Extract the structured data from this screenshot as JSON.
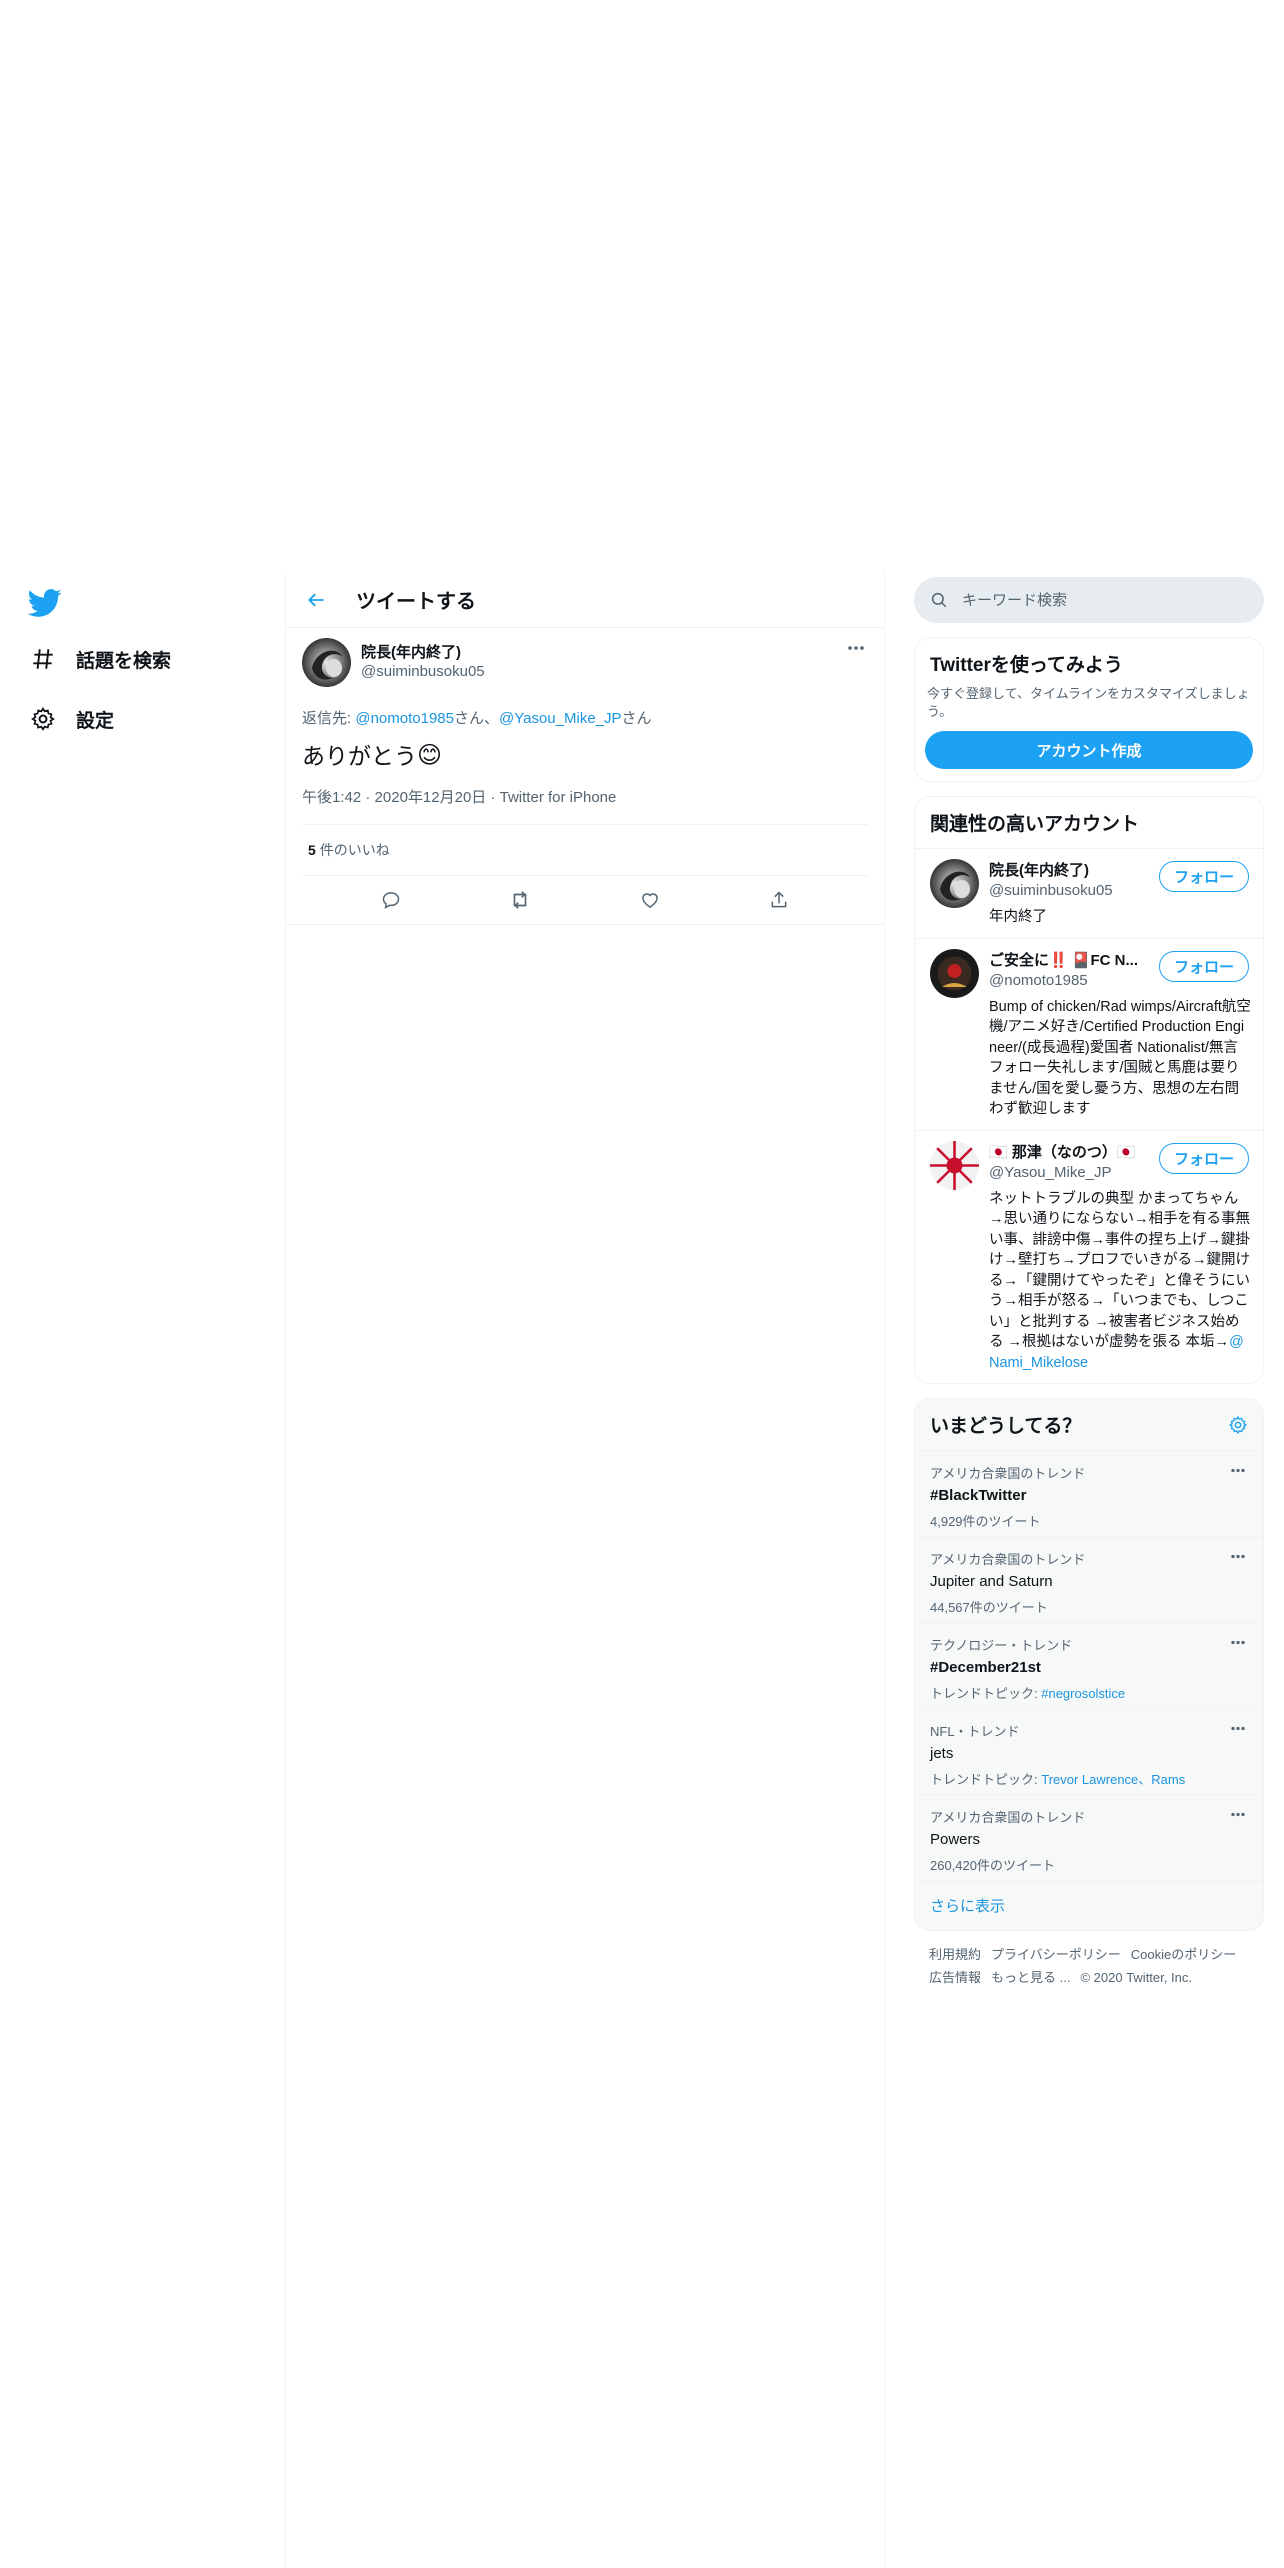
{
  "nav": {
    "items": [
      {
        "label": "話題を検索"
      },
      {
        "label": "設定"
      }
    ]
  },
  "main": {
    "header_title": "ツイートする",
    "tweet": {
      "author_name": "院長(年内終了)",
      "author_handle": "@suiminbusoku05",
      "reply_prefix": "返信先: ",
      "reply_mention_1": "@nomoto1985",
      "reply_sep": "さん、",
      "reply_mention_2": "@Yasou_Mike_JP",
      "reply_suffix": "さん",
      "text": "ありがとう",
      "emoji": "😊",
      "time": "午後1:42",
      "date": "2020年12月20日",
      "source": "Twitter for iPhone",
      "likes_count": "5",
      "likes_label": "件のいいね"
    }
  },
  "sidebar": {
    "search_placeholder": "キーワード検索",
    "signup": {
      "title": "Twitterを使ってみよう",
      "desc": "今すぐ登録して、タイムラインをカスタマイズしましょう。",
      "button": "アカウント作成"
    },
    "relevant": {
      "title": "関連性の高いアカウント",
      "follow_label": "フォロー",
      "users": [
        {
          "name": "院長(年内終了)",
          "handle": "@suiminbusoku05",
          "bio": "年内終了"
        },
        {
          "name": "ご安全に‼️ 🎴FC N...",
          "handle": "@nomoto1985",
          "bio": "Bump of chicken/Rad wimps/Aircraft航空機/アニメ好き/Certified Production Engineer/(成長過程)愛国者 Nationalist/無言フォロー失礼します/国賊と馬鹿は要りません/国を愛し憂う方、思想の左右問わず歓迎します"
        },
        {
          "name": "🇯🇵 那津（なのつ）🇯🇵",
          "handle": "@Yasou_Mike_JP",
          "bio": "ネットトラブルの典型 かまってちゃん→思い通りにならない→相手を有る事無い事、誹謗中傷→事件の捏ち上げ→鍵掛け→壁打ち→プロフでいきがる→鍵開ける→「鍵開けてやったぞ」と偉そうにいう→相手が怒る→「いつまでも、しつこい」と批判する →被害者ビジネス始める →根拠はないが虚勢を張る 本垢→",
          "bio_link": "@Nami_Mikelose"
        }
      ]
    },
    "trends": {
      "title": "いまどうしてる？",
      "items": [
        {
          "context": "アメリカ合衆国のトレンド",
          "name": "#BlackTwitter",
          "sub": "4,929件のツイート"
        },
        {
          "context": "アメリカ合衆国のトレンド",
          "name": "Jupiter and Saturn",
          "sub": "44,567件のツイート"
        },
        {
          "context": "テクノロジー・トレンド",
          "name": "#December21st",
          "sub_label": "トレンドトピック: ",
          "sub_link": "#negrosolstice"
        },
        {
          "context": "NFL・トレンド",
          "name": "jets",
          "sub_label": "トレンドトピック: ",
          "sub_link": "Trevor Lawrence、Rams"
        },
        {
          "context": "アメリカ合衆国のトレンド",
          "name": "Powers",
          "sub": "260,420件のツイート"
        }
      ],
      "show_more": "さらに表示"
    },
    "footer": {
      "links": [
        "利用規約",
        "プライバシーポリシー",
        "Cookieのポリシー",
        "広告情報",
        "もっと見る ..."
      ],
      "copyright": "© 2020 Twitter, Inc."
    }
  },
  "colors": {
    "accent": "#1da1f2",
    "link": "#1b95e0",
    "muted": "#536471"
  }
}
